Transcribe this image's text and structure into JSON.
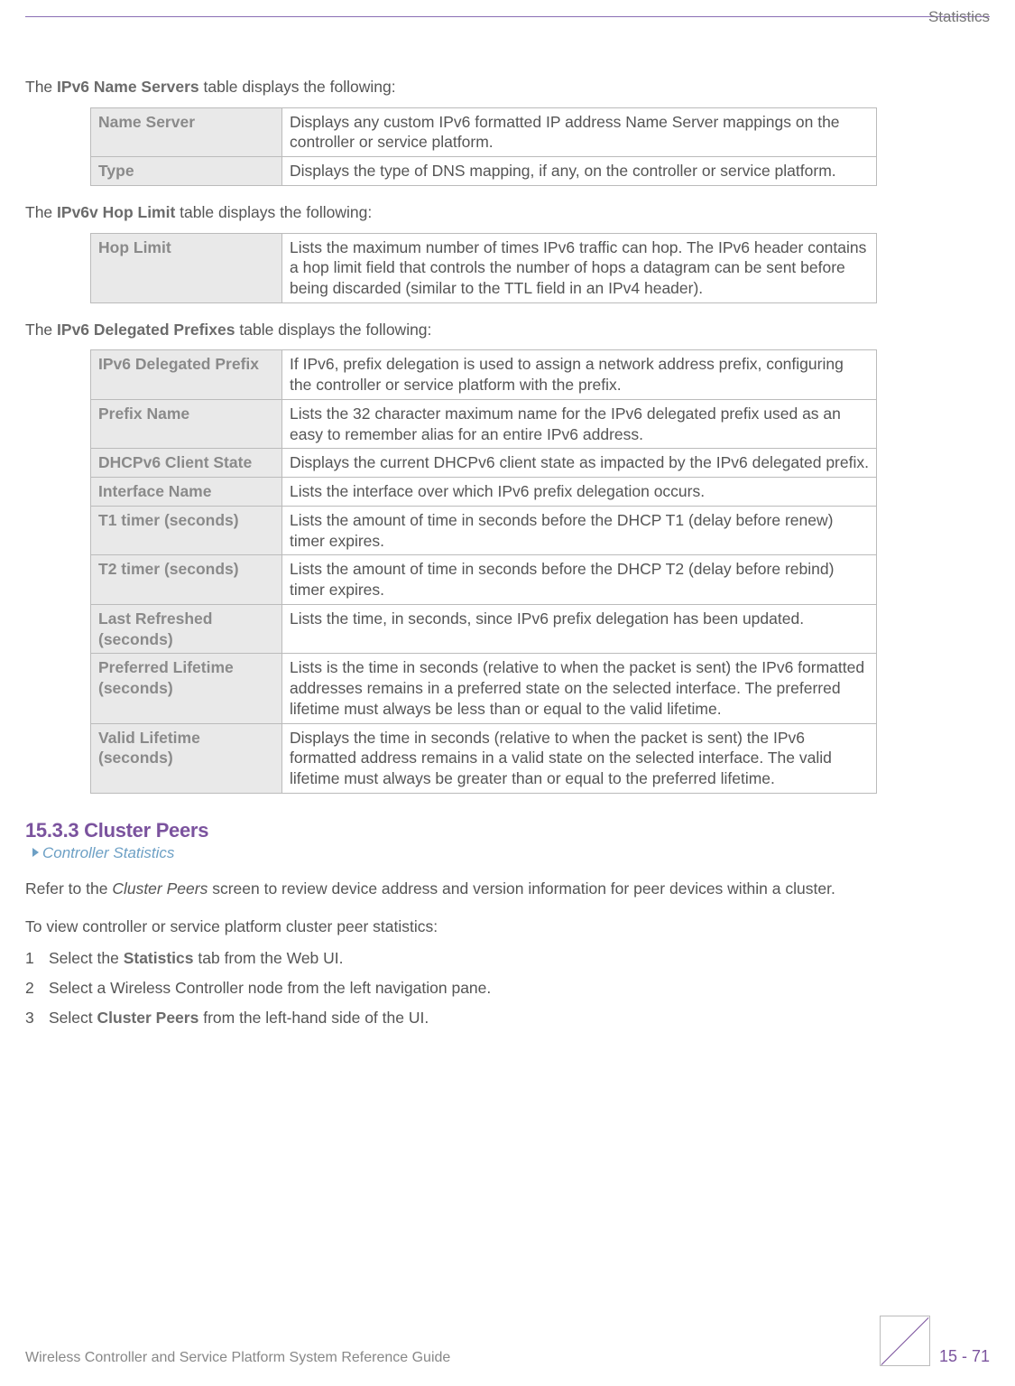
{
  "header": {
    "section": "Statistics"
  },
  "intro1": {
    "pre": "The ",
    "bold": "IPv6 Name Servers",
    "post": " table displays the following:"
  },
  "table1": {
    "rows": [
      {
        "label": "Name Server",
        "desc": "Displays any custom IPv6 formatted IP address Name Server mappings on the controller or service platform."
      },
      {
        "label": "Type",
        "desc": "Displays the type of DNS mapping, if any, on the controller or service platform."
      }
    ]
  },
  "intro2": {
    "pre": "The ",
    "bold": "IPv6v Hop Limit",
    "post": " table displays the following:"
  },
  "table2": {
    "rows": [
      {
        "label": "Hop Limit",
        "desc": "Lists the maximum number of times IPv6 traffic can hop. The IPv6 header contains a hop limit field that controls the number of hops a datagram can be sent before being discarded (similar to the TTL field in an IPv4 header)."
      }
    ]
  },
  "intro3": {
    "pre": "The ",
    "bold": "IPv6 Delegated Prefixes",
    "post": " table displays the following:"
  },
  "table3": {
    "rows": [
      {
        "label": "IPv6 Delegated Prefix",
        "desc": "If IPv6, prefix delegation is used to assign a network address prefix, configuring the controller or service platform with the prefix."
      },
      {
        "label": "Prefix Name",
        "desc": "Lists the 32 character maximum name for the IPv6 delegated prefix used as an easy to remember alias for an entire IPv6 address."
      },
      {
        "label": "DHCPv6 Client State",
        "desc": "Displays the current DHCPv6 client state as impacted by the IPv6 delegated prefix."
      },
      {
        "label": "Interface Name",
        "desc": "Lists the interface over which IPv6 prefix delegation occurs."
      },
      {
        "label": "T1 timer (seconds)",
        "desc": "Lists the amount of time in seconds before the DHCP T1 (delay before renew) timer expires."
      },
      {
        "label": "T2 timer (seconds)",
        "desc": "Lists the amount of time in seconds before the DHCP T2 (delay before rebind) timer expires."
      },
      {
        "label": "Last Refreshed (seconds)",
        "desc": "Lists the time, in seconds, since IPv6 prefix delegation has been updated."
      },
      {
        "label": "Preferred Lifetime (seconds)",
        "desc": "Lists is the time in seconds (relative to when the packet is sent) the IPv6 formatted addresses remains in a preferred state on the selected interface. The preferred lifetime must always be less than or equal to the valid lifetime."
      },
      {
        "label": "Valid Lifetime (seconds)",
        "desc": "Displays the time in seconds (relative to when the packet is sent) the IPv6 formatted address remains in a valid state on the selected interface. The valid lifetime must always be greater than or equal to the preferred lifetime."
      }
    ]
  },
  "section": {
    "heading": "15.3.3 Cluster Peers",
    "breadcrumb": "Controller Statistics",
    "para1_pre": "Refer to the ",
    "para1_em": "Cluster Peers",
    "para1_post": " screen to review device address and version information for peer devices within a cluster.",
    "para2": "To view controller or service platform cluster peer statistics:",
    "steps": [
      {
        "num": "1",
        "pre": "Select the ",
        "bold": "Statistics",
        "post": " tab from the Web UI."
      },
      {
        "num": "2",
        "pre": "Select a Wireless Controller node from the left navigation pane.",
        "bold": "",
        "post": ""
      },
      {
        "num": "3",
        "pre": "Select ",
        "bold": "Cluster Peers",
        "post": " from the left-hand side of the UI."
      }
    ]
  },
  "footer": {
    "left": "Wireless Controller and Service Platform System Reference Guide",
    "page": "15 - 71"
  }
}
